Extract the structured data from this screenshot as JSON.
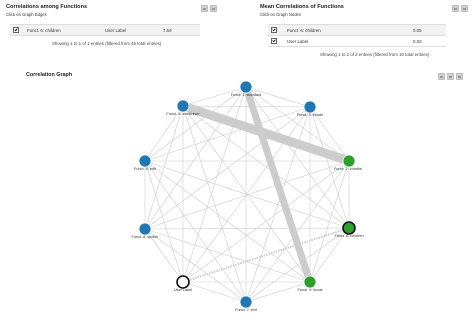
{
  "left_panel": {
    "title": "Correlations among Functions",
    "subtitle": "Click on Graph Edges",
    "rows": [
      {
        "func": "Funct. 6: children",
        "label": "User Label",
        "value": "7.64"
      }
    ],
    "showing": "Showing 1 to 1 of 1 entries (filtered from 45 total entries)"
  },
  "right_panel": {
    "title": "Mean Correlations of Functions",
    "subtitle": "Click on Graph Nodes",
    "rows": [
      {
        "func": "Funct. 6: children",
        "value": "0.05"
      },
      {
        "func": "User Label",
        "value": "0.02"
      }
    ],
    "showing": "Showing 1 to 2 of 2 entries (filtered from 10 total entries)"
  },
  "graph": {
    "title": "Correlation Graph",
    "colors": {
      "blue": "#1f77b4",
      "green": "#2ca02c",
      "white": "#ffffff",
      "edge": "#cccccc"
    },
    "nodes": [
      {
        "id": "f1",
        "label": "Funct. 1: standard",
        "color": "blue"
      },
      {
        "id": "f2",
        "label": "Funct. 2: zombie",
        "color": "green"
      },
      {
        "id": "f3",
        "label": "Funct. 3: exude",
        "color": "blue"
      },
      {
        "id": "f4",
        "label": "Funct. 4: scrutiniser",
        "color": "blue"
      },
      {
        "id": "f5",
        "label": "Funct. 5: edit",
        "color": "blue"
      },
      {
        "id": "f6",
        "label": "Funct. 6: children",
        "color": "green",
        "selected": true
      },
      {
        "id": "f7",
        "label": "Funct. 7: exit",
        "color": "blue"
      },
      {
        "id": "f8",
        "label": "Funct. 8: spoiler",
        "color": "blue"
      },
      {
        "id": "f9",
        "label": "Funct. 9: boost",
        "color": "green"
      },
      {
        "id": "user",
        "label": "User Label",
        "color": "white"
      }
    ],
    "edges": [
      {
        "a": "f4",
        "b": "f2",
        "w": 9
      },
      {
        "a": "f1",
        "b": "f9",
        "w": 7
      },
      {
        "a": "user",
        "b": "f6",
        "w": 2,
        "dotted": true
      },
      {
        "a": "f1",
        "b": "f4",
        "w": 0.6
      },
      {
        "a": "f1",
        "b": "f3",
        "w": 0.6
      },
      {
        "a": "f1",
        "b": "f5",
        "w": 0.6
      },
      {
        "a": "f1",
        "b": "f2",
        "w": 0.6
      },
      {
        "a": "f1",
        "b": "f8",
        "w": 0.6
      },
      {
        "a": "f1",
        "b": "f6",
        "w": 0.6
      },
      {
        "a": "f1",
        "b": "f7",
        "w": 0.6
      },
      {
        "a": "f1",
        "b": "user",
        "w": 0.6
      },
      {
        "a": "f3",
        "b": "f5",
        "w": 0.6
      },
      {
        "a": "f3",
        "b": "f2",
        "w": 0.6
      },
      {
        "a": "f3",
        "b": "f8",
        "w": 0.6
      },
      {
        "a": "f3",
        "b": "f6",
        "w": 0.6
      },
      {
        "a": "f3",
        "b": "f7",
        "w": 0.6
      },
      {
        "a": "f3",
        "b": "user",
        "w": 0.6
      },
      {
        "a": "f3",
        "b": "f9",
        "w": 0.6
      },
      {
        "a": "f3",
        "b": "f4",
        "w": 0.6
      },
      {
        "a": "f4",
        "b": "f5",
        "w": 0.6
      },
      {
        "a": "f4",
        "b": "f8",
        "w": 0.6
      },
      {
        "a": "f4",
        "b": "f6",
        "w": 0.6
      },
      {
        "a": "f4",
        "b": "f7",
        "w": 0.6
      },
      {
        "a": "f4",
        "b": "user",
        "w": 0.6
      },
      {
        "a": "f4",
        "b": "f9",
        "w": 0.6
      },
      {
        "a": "f5",
        "b": "f2",
        "w": 0.6
      },
      {
        "a": "f5",
        "b": "f8",
        "w": 0.6
      },
      {
        "a": "f5",
        "b": "f6",
        "w": 0.6
      },
      {
        "a": "f5",
        "b": "f7",
        "w": 0.6
      },
      {
        "a": "f5",
        "b": "user",
        "w": 0.6
      },
      {
        "a": "f5",
        "b": "f9",
        "w": 0.6
      },
      {
        "a": "f2",
        "b": "f8",
        "w": 0.6
      },
      {
        "a": "f2",
        "b": "f6",
        "w": 0.6
      },
      {
        "a": "f2",
        "b": "f7",
        "w": 0.6
      },
      {
        "a": "f2",
        "b": "user",
        "w": 0.6
      },
      {
        "a": "f2",
        "b": "f9",
        "w": 0.6
      },
      {
        "a": "f8",
        "b": "f6",
        "w": 0.6
      },
      {
        "a": "f8",
        "b": "f7",
        "w": 0.6
      },
      {
        "a": "f8",
        "b": "user",
        "w": 0.6
      },
      {
        "a": "f8",
        "b": "f9",
        "w": 0.6
      },
      {
        "a": "f6",
        "b": "f7",
        "w": 0.6
      },
      {
        "a": "f6",
        "b": "f9",
        "w": 0.6
      },
      {
        "a": "f7",
        "b": "user",
        "w": 0.6
      },
      {
        "a": "f7",
        "b": "f9",
        "w": 0.6
      },
      {
        "a": "user",
        "b": "f9",
        "w": 0.6
      }
    ]
  }
}
